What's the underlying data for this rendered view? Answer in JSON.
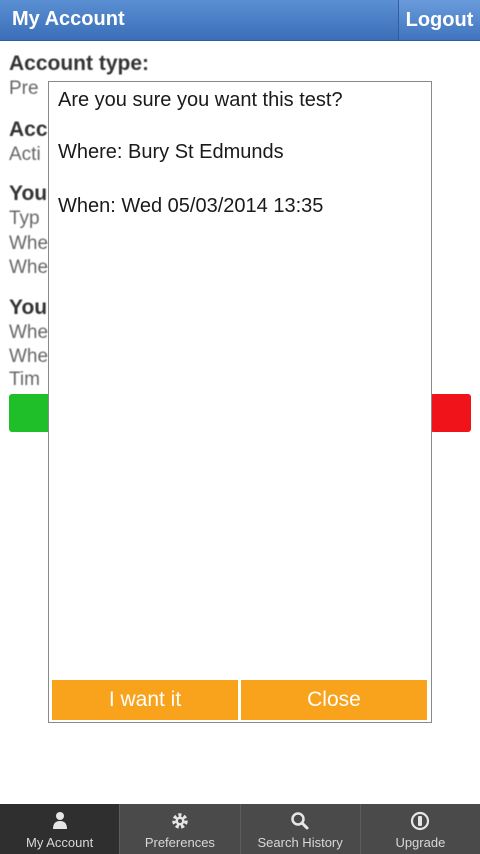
{
  "header": {
    "title": "My Account",
    "logout_label": "Logout"
  },
  "background": {
    "account_type_heading": "Account type:",
    "account_type_value": "Pre",
    "status_heading": "Acc",
    "status_value": "Acti",
    "section2_heading": "You",
    "section2_line1": "Typ",
    "section2_line2": "Whe",
    "section2_line3": "Whe",
    "section3_heading": "You",
    "section3_line1": "Whe",
    "section3_line2": "Whe",
    "section3_line3": "Tim"
  },
  "dialog": {
    "question": "Are you sure you want this test?",
    "where": "Where: Bury St Edmunds",
    "when": "When: Wed 05/03/2014 13:35",
    "want_label": "I want it",
    "close_label": "Close"
  },
  "tabs": [
    {
      "label": "My Account",
      "icon": "person-icon"
    },
    {
      "label": "Preferences",
      "icon": "gear-icon"
    },
    {
      "label": "Search History",
      "icon": "search-icon"
    },
    {
      "label": "Upgrade",
      "icon": "upgrade-icon"
    }
  ],
  "colors": {
    "header": "#3a6fb8",
    "accent_orange": "#f9a21b",
    "green": "#1fbf2a",
    "red": "#f0141a",
    "tabbar": "#4a4a4a"
  }
}
